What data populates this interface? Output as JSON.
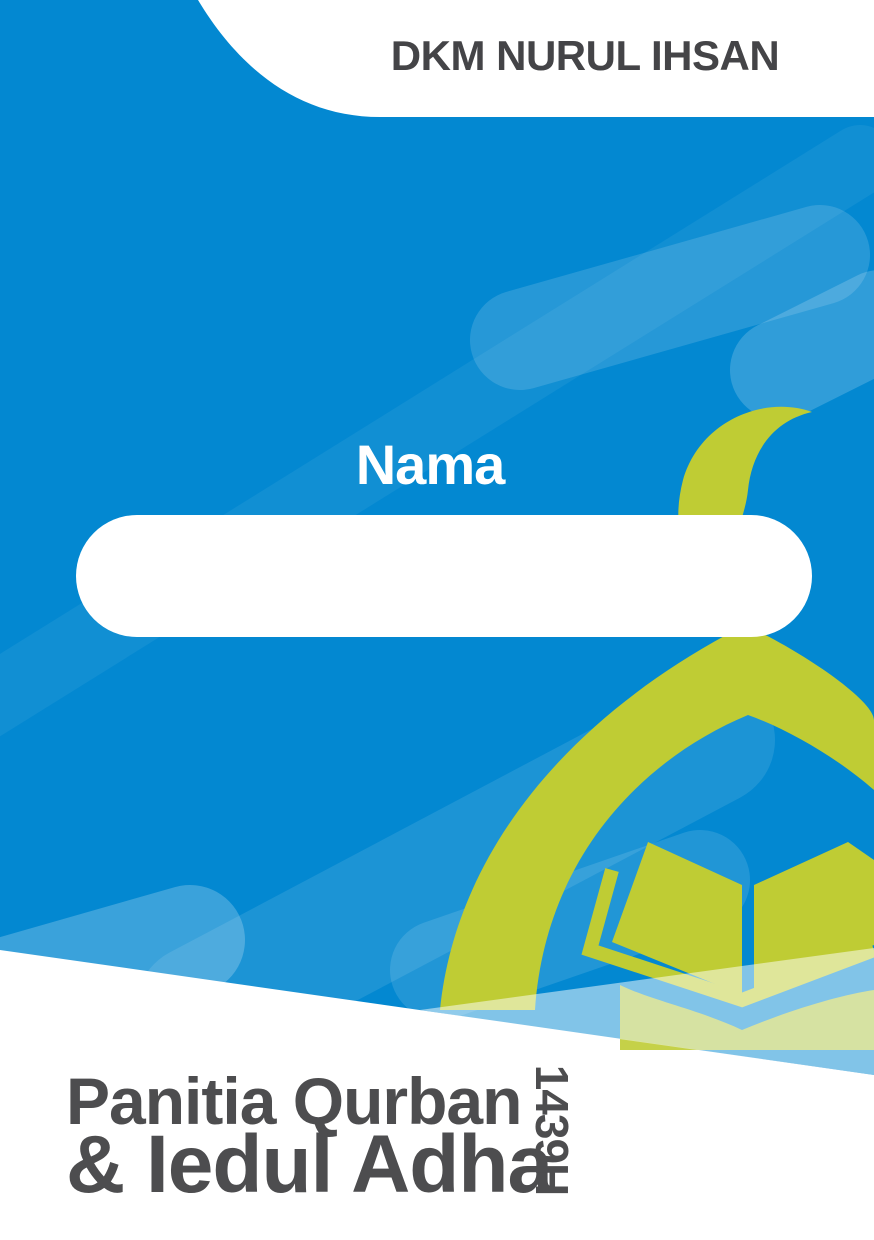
{
  "header": {
    "organization": "DKM NURUL IHSAN"
  },
  "name_field": {
    "label": "Nama",
    "value": "",
    "placeholder": ""
  },
  "event": {
    "line1": "Panitia Qurban",
    "line2": "& Iedul Adha",
    "year": "1439H"
  },
  "colors": {
    "background_blue": "#0388d1",
    "accent_green": "#bfcc34",
    "text_dark": "#4d4d4f",
    "white": "#ffffff"
  },
  "icons": [
    "crescent-moon-icon",
    "mosque-dome-icon",
    "open-quran-icon"
  ]
}
